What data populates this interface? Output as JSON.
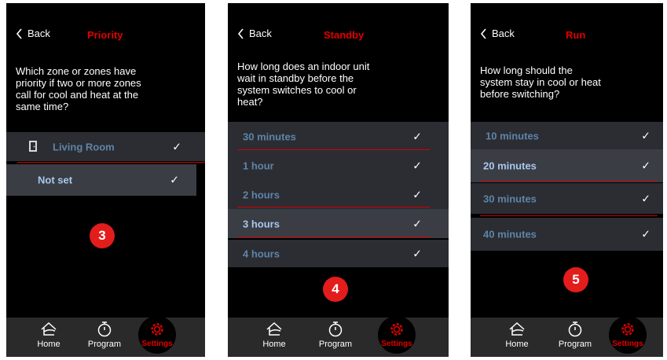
{
  "colors": {
    "accent": "#e10000",
    "badge": "#e31c1c",
    "row": "#2b2d33",
    "row_selected": "#3a3d44",
    "label": "#5f84a8",
    "label_selected": "#a9c8ee"
  },
  "nav": {
    "home": "Home",
    "program": "Program",
    "settings": "Settings"
  },
  "screens": [
    {
      "back": "Back",
      "title": "Priority",
      "question": "Which zone or zones have\npriority if two or more zones\ncall for cool and heat at the\nsame time?",
      "options": [
        {
          "label": "Living Room",
          "icon": "door-icon",
          "selected": false
        },
        {
          "label": "Not set",
          "selected": true
        }
      ],
      "step": "3"
    },
    {
      "back": "Back",
      "title": "Standby",
      "question": "How long does an indoor unit\nwait in standby before the\nsystem switches to cool or\nheat?",
      "options": [
        {
          "label": "30 minutes",
          "selected": false
        },
        {
          "label": "1 hour",
          "selected": false
        },
        {
          "label": "2 hours",
          "selected": false
        },
        {
          "label": "3 hours",
          "selected": true
        },
        {
          "label": "4 hours",
          "selected": false
        }
      ],
      "step": "4"
    },
    {
      "back": "Back",
      "title": "Run",
      "question": "How long should the\nsystem stay in cool or heat\nbefore switching?",
      "options": [
        {
          "label": "10 minutes",
          "selected": false
        },
        {
          "label": "20 minutes",
          "selected": true
        },
        {
          "label": "30 minutes",
          "selected": false
        },
        {
          "label": "40 minutes",
          "selected": false
        }
      ],
      "step": "5"
    }
  ]
}
